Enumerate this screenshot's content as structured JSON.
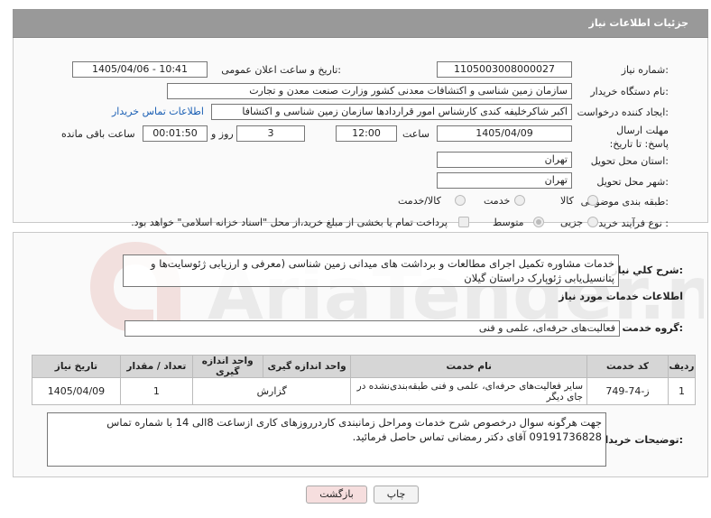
{
  "header": {
    "title": "جزئیات اطلاعات نیاز"
  },
  "fields": {
    "need_number_label": "شماره نیاز:",
    "need_number": "1105003008000027",
    "announce_label": "تاریخ و ساعت اعلان عمومی:",
    "announce_value": "1405/04/06 - 10:41",
    "buyer_org_label": "نام دستگاه خریدار:",
    "buyer_org": "سازمان زمین شناسی و اکتشافات معدنی کشور وزارت صنعت معدن و تجارت",
    "creator_label": "ایجاد کننده درخواست:",
    "creator": "اکبر شاکرخلیفه کندی کارشناس امور قراردادها سازمان زمین شناسی و اکتشافا",
    "contact_link": "اطلاعات تماس خریدار",
    "deadline_label": "مهلت ارسال پاسخ: تا تاریخ:",
    "deadline_date": "1405/04/09",
    "time_label": "ساعت",
    "deadline_time": "12:00",
    "days_value": "3",
    "days_label": "روز و",
    "remaining_time": "00:01:50",
    "remaining_label": "ساعت باقی مانده",
    "province_label": "استان محل تحویل:",
    "province": "تهران",
    "city_label": "شهر محل تحویل:",
    "city": "تهران",
    "category_label": "طبقه بندی موضوعی:",
    "category_options": [
      "کالا",
      "خدمت",
      "کالا/خدمت"
    ],
    "process_label": "نوع فرآیند خرید :",
    "process_options": [
      "جزیی",
      "متوسط"
    ],
    "payment_note": "پرداخت تمام یا بخشی از مبلغ خرید،از محل \"اسناد خزانه اسلامی\" خواهد بود."
  },
  "description": {
    "label": "شرح کلي نياز:",
    "text": "خدمات مشاوره تکمیل اجرای مطالعات و برداشت های میدانی زمین شناسی (معرفی و ارزیابی ژئوسایت‌ها و پتانسیل‌یابی ژئوپارک دراستان گیلان"
  },
  "services": {
    "section_title": "اطلاعات خدمات مورد نیاز",
    "group_label": "گروه خدمت:",
    "group_value": "فعالیت‌های حرفه‌ای، علمی و فنی",
    "columns": [
      "ردیف",
      "کد خدمت",
      "نام خدمت",
      "واحد اندازه گیری",
      "تعداد / مقدار",
      "تاریخ نیاز"
    ],
    "rows": [
      {
        "row": "1",
        "code": "ز-74-749",
        "name": "سایر فعالیت‌های حرفه‌ای، علمی و فنی طبقه‌بندی‌نشده در جای دیگر",
        "unit": "گزارش",
        "qty": "1",
        "date": "1405/04/09"
      }
    ]
  },
  "buyer_notes": {
    "label": "توضیحات خریدار:",
    "text": "جهت هرگونه سوال درخصوص شرح خدمات ومراحل زمانبندی کاردرروزهای کاری ازساعت 8الی 14 با شماره تماس 09191736828 آقای دکتر رمضانی تماس حاصل فرمائید."
  },
  "buttons": {
    "print": "چاپ",
    "back": "بازگشت"
  },
  "watermark": "AriaTender.net",
  "colors": {
    "header_bg": "#999999",
    "link": "#1a5fb4",
    "back_btn_bg": "#f6dede"
  }
}
